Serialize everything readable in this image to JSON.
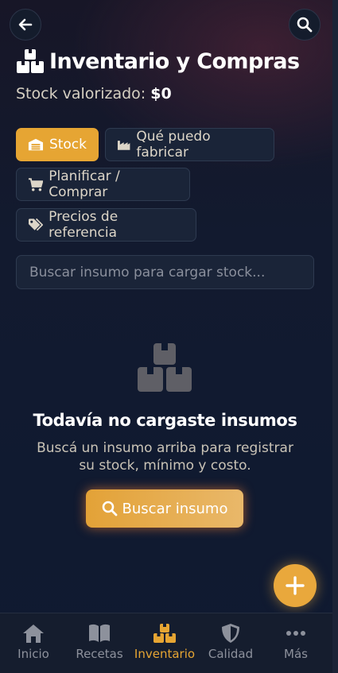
{
  "header": {
    "back_icon": "arrow-left-icon",
    "search_icon": "search-icon",
    "title_icon": "boxes-icon",
    "title": "Inventario y Compras",
    "stock_label": "Stock valorizado:",
    "stock_value": "$0"
  },
  "tabs": [
    {
      "label": "Stock",
      "icon": "warehouse-icon",
      "active": true
    },
    {
      "label": "Qué puedo fabricar",
      "icon": "factory-icon",
      "active": false
    },
    {
      "label": "Planificar / Comprar",
      "icon": "cart-icon",
      "active": false
    },
    {
      "label": "Precios de referencia",
      "icon": "tags-icon",
      "active": false
    }
  ],
  "search": {
    "placeholder": "Buscar insumo para cargar stock..."
  },
  "empty_state": {
    "icon": "boxes-icon",
    "title": "Todavía no cargaste insumos",
    "description": "Buscá un insumo arriba para registrar su stock, mínimo y costo.",
    "button_label": "Buscar insumo",
    "button_icon": "search-icon"
  },
  "fab": {
    "icon": "plus-icon"
  },
  "nav": [
    {
      "label": "Inicio",
      "icon": "home-icon",
      "active": false
    },
    {
      "label": "Recetas",
      "icon": "book-icon",
      "active": false
    },
    {
      "label": "Inventario",
      "icon": "boxes-icon",
      "active": true
    },
    {
      "label": "Calidad",
      "icon": "shield-icon",
      "active": false
    },
    {
      "label": "Más",
      "icon": "more-icon",
      "active": false
    }
  ],
  "colors": {
    "accent": "#e6a533",
    "background": "#0f1a31",
    "surface": "#1a2438"
  }
}
